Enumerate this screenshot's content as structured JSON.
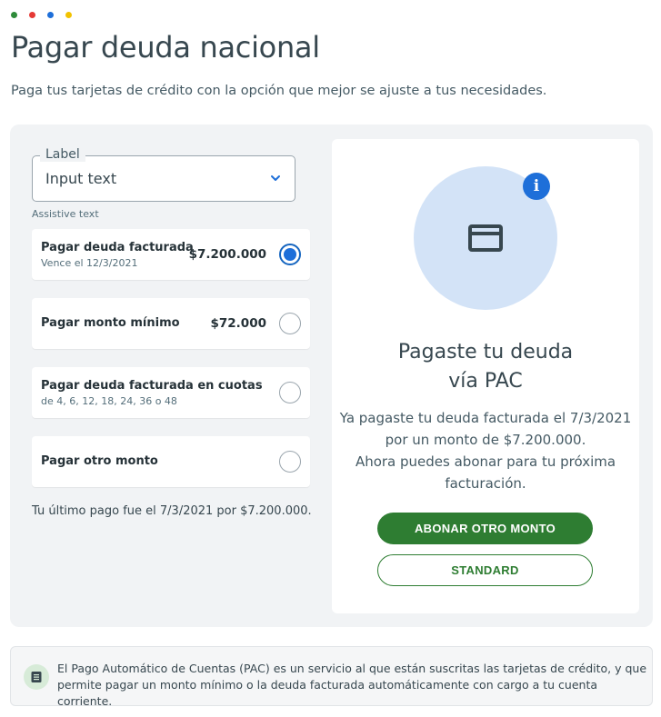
{
  "window_dots": {
    "colors": [
      "#2e8b3a",
      "#e53935",
      "#1e6fd9",
      "#f2c200"
    ]
  },
  "header": {
    "title": "Pagar deuda nacional",
    "subtitle": "Paga tus tarjetas de crédito con la opción que mejor se ajuste a tus necesidades."
  },
  "select": {
    "label": "Label",
    "value": "Input text",
    "assistive": "Assistive text"
  },
  "options": [
    {
      "label": "Pagar deuda facturada",
      "sub": "Vence el 12/3/2021",
      "amount": "$7.200.000",
      "selected": true
    },
    {
      "label": "Pagar monto mínimo",
      "sub": "",
      "amount": "$72.000",
      "selected": false
    },
    {
      "label": "Pagar deuda facturada en cuotas",
      "sub": "de 4, 6, 12, 18, 24, 36 o 48",
      "amount": "",
      "selected": false
    },
    {
      "label": "Pagar otro monto",
      "sub": "",
      "amount": "",
      "selected": false
    }
  ],
  "last_payment": "Tu último pago fue el 7/3/2021 por $7.200.000.",
  "result": {
    "icon": "credit-card-icon",
    "info_icon": "info-icon",
    "title_line1": "Pagaste tu deuda",
    "title_line2": "vía PAC",
    "text_line1": "Ya pagaste tu deuda facturada el 7/3/2021",
    "text_line2": "por un monto de $7.200.000.",
    "text_line3": "Ahora puedes abonar para tu próxima",
    "text_line4": "facturación.",
    "primary_button": "ABONAR OTRO MONTO",
    "secondary_button": "STANDARD"
  },
  "notice": {
    "icon": "document-icon",
    "text": "El Pago Automático de Cuentas (PAC) es un servicio al que están suscritas las tarjetas de crédito, y que permite pagar un monto mínimo o la deuda facturada automáticamente con cargo a tu cuenta corriente."
  },
  "colors": {
    "accent_blue": "#1e6fd9",
    "brand_green": "#2e7d32",
    "text": "#37474f"
  }
}
